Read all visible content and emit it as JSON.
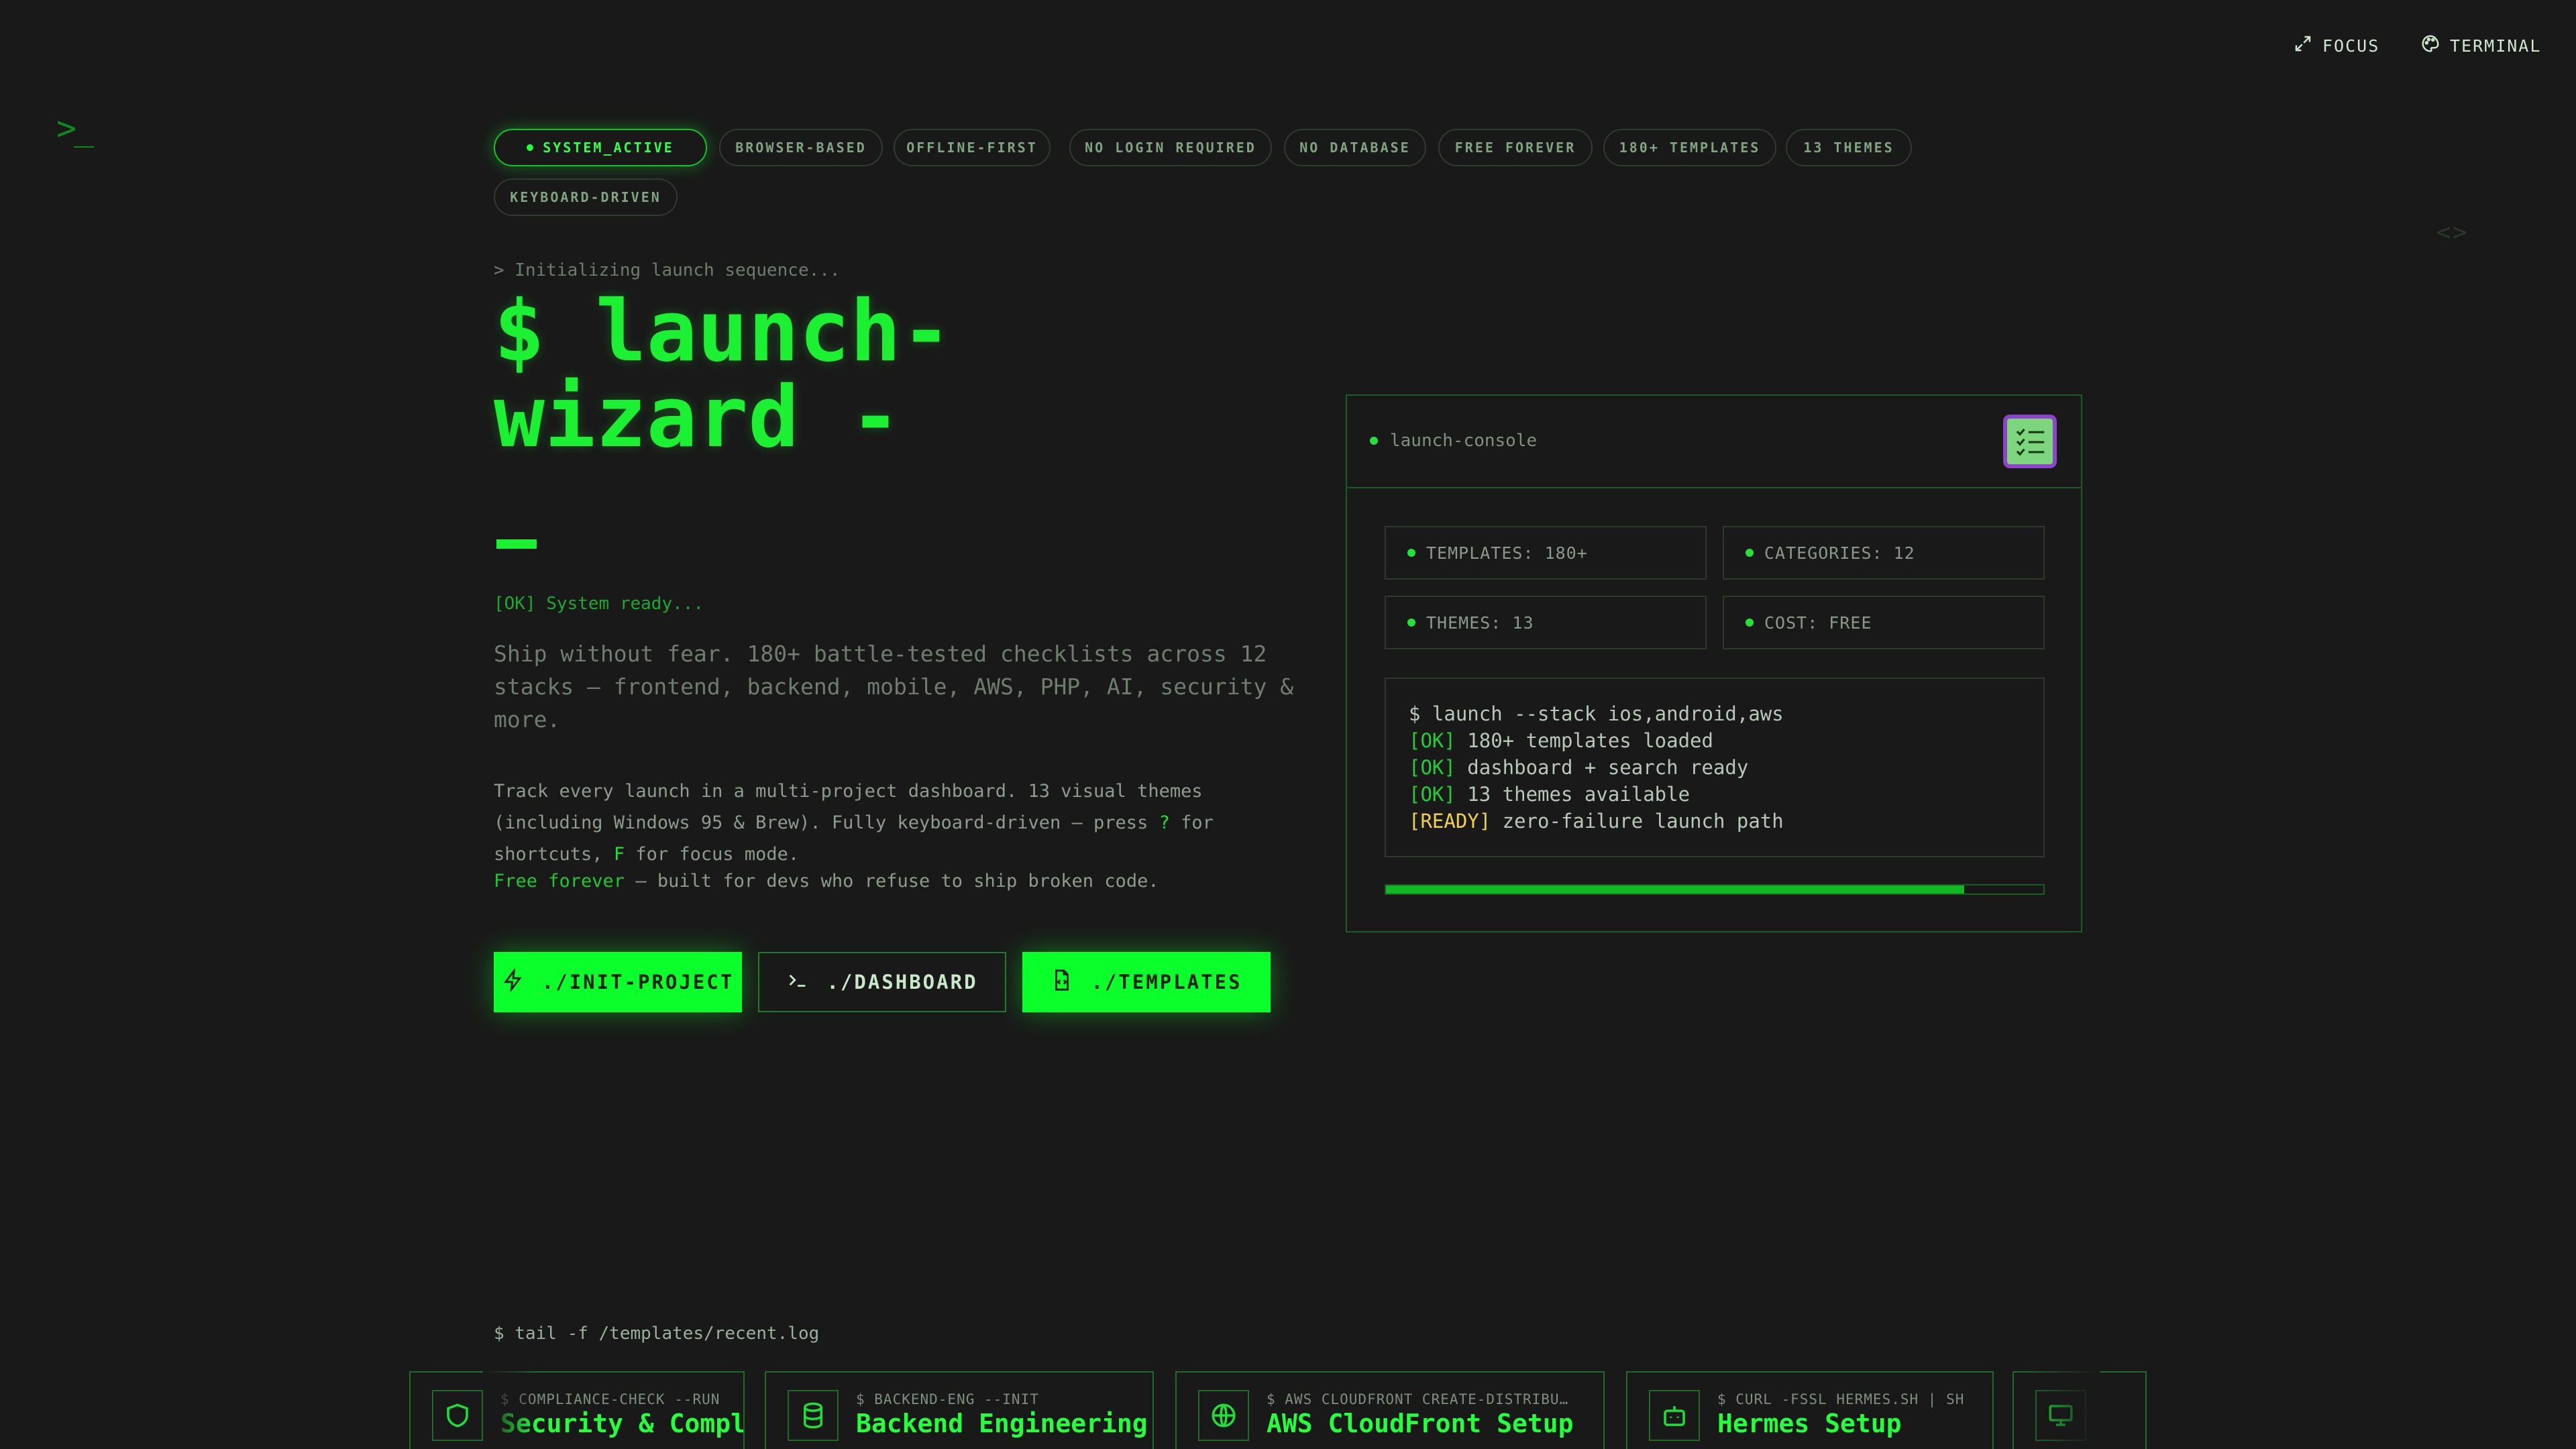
{
  "topbar": {
    "focus_label": "FOCUS",
    "terminal_label": "TERMINAL"
  },
  "logo": ">_",
  "badges": [
    "SYSTEM_ACTIVE",
    "BROWSER-BASED",
    "OFFLINE-FIRST",
    "NO LOGIN REQUIRED",
    "NO DATABASE",
    "FREE FOREVER",
    "180+ TEMPLATES",
    "13 THEMES",
    "KEYBOARD-DRIVEN"
  ],
  "code_icon": "<>",
  "hero": {
    "init_line": "> Initializing launch sequence...",
    "headline_1": "$ launch-",
    "headline_2": "wizard -",
    "ok_line": "[OK] System ready...",
    "lead": "Ship without fear. 180+ battle-tested checklists across 12 stacks — frontend, backend, mobile, AWS, PHP, AI, security & more.",
    "desc_1": "Track every launch in a multi-project dashboard. 13 visual themes (including Windows 95 & Brew). Fully keyboard-driven — press ",
    "desc_key1": "?",
    "desc_2": " for shortcuts, ",
    "desc_key2": "F",
    "desc_3": " for focus mode.",
    "free_1": "Free forever",
    "free_2": " — built for devs who refuse to ship broken code."
  },
  "buttons": {
    "init": "./INIT-PROJECT",
    "dashboard": "./DASHBOARD",
    "templates": "./TEMPLATES"
  },
  "console": {
    "title": "launch-console",
    "stats": [
      "TEMPLATES: 180+",
      "CATEGORIES: 12",
      "THEMES: 13",
      "COST: FREE"
    ],
    "terminal": {
      "line1": "$ launch --stack ios,android,aws",
      "ok1_tag": "[OK]",
      "ok1_text": " 180+ templates loaded",
      "ok2_tag": "[OK]",
      "ok2_text": " dashboard + search ready",
      "ok3_tag": "[OK]",
      "ok3_text": " 13 themes available",
      "ready_tag": "[READY]",
      "ready_text": " zero-failure launch path"
    },
    "progress": 0.88
  },
  "recent": {
    "tail_cmd": "$ tail -f /templates/recent.log",
    "cards": [
      {
        "cmd": "$ COMPLIANCE-CHECK --RUN",
        "name": "Security & Compliance…",
        "icon": "shield-icon"
      },
      {
        "cmd": "$ BACKEND-ENG --INIT",
        "name": "Backend Engineering",
        "icon": "database-icon"
      },
      {
        "cmd": "$ AWS CLOUDFRONT CREATE-DISTRIBU…",
        "name": "AWS CloudFront Setup",
        "icon": "globe-icon"
      },
      {
        "cmd": "$ CURL -FSSL HERMES.SH | SH",
        "name": "Hermes Setup",
        "icon": "bot-icon"
      },
      {
        "cmd": "",
        "name": "",
        "icon": "monitor-icon"
      }
    ]
  },
  "colors": {
    "background": "#191919",
    "accent": "#0bff2a",
    "border": "#1b5c22",
    "ready": "#f0d24a"
  }
}
